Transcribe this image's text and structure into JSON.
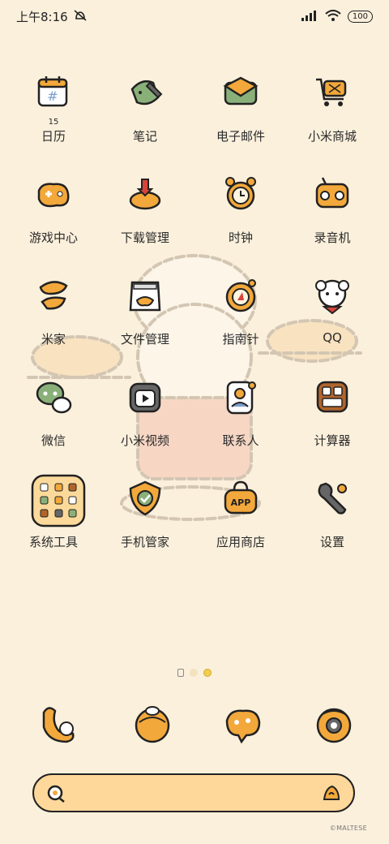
{
  "status": {
    "time": "上午8:16",
    "battery": "100",
    "icons": [
      "mute-bell-icon",
      "signal-icon",
      "wifi-icon",
      "battery-icon"
    ]
  },
  "apps": [
    {
      "label": "日历",
      "icon": "calendar-icon",
      "badge": "15"
    },
    {
      "label": "笔记",
      "icon": "notes-icon"
    },
    {
      "label": "电子邮件",
      "icon": "mail-icon"
    },
    {
      "label": "小米商城",
      "icon": "shopping-cart-icon"
    },
    {
      "label": "游戏中心",
      "icon": "game-controller-icon"
    },
    {
      "label": "下载管理",
      "icon": "download-icon"
    },
    {
      "label": "时钟",
      "icon": "alarm-clock-icon"
    },
    {
      "label": "录音机",
      "icon": "recorder-icon"
    },
    {
      "label": "米家",
      "icon": "mijia-icon"
    },
    {
      "label": "文件管理",
      "icon": "file-bag-icon"
    },
    {
      "label": "指南针",
      "icon": "compass-icon"
    },
    {
      "label": "QQ",
      "icon": "qq-dog-icon"
    },
    {
      "label": "微信",
      "icon": "wechat-icon"
    },
    {
      "label": "小米视频",
      "icon": "video-icon"
    },
    {
      "label": "联系人",
      "icon": "contacts-icon"
    },
    {
      "label": "计算器",
      "icon": "calculator-icon"
    },
    {
      "label": "系统工具",
      "icon": "folder-icon"
    },
    {
      "label": "手机管家",
      "icon": "security-shield-icon"
    },
    {
      "label": "应用商店",
      "icon": "app-store-bag-icon"
    },
    {
      "label": "设置",
      "icon": "settings-wrench-icon"
    }
  ],
  "dock": [
    {
      "icon": "phone-dog-icon"
    },
    {
      "icon": "messages-bread-icon"
    },
    {
      "icon": "browser-bread-icon"
    },
    {
      "icon": "camera-icon"
    }
  ],
  "search": {
    "placeholder": ""
  },
  "watermark": "©MALTESE",
  "colors": {
    "background": "#fbf0dc",
    "accent": "#f2a83b",
    "outline": "#222222"
  }
}
